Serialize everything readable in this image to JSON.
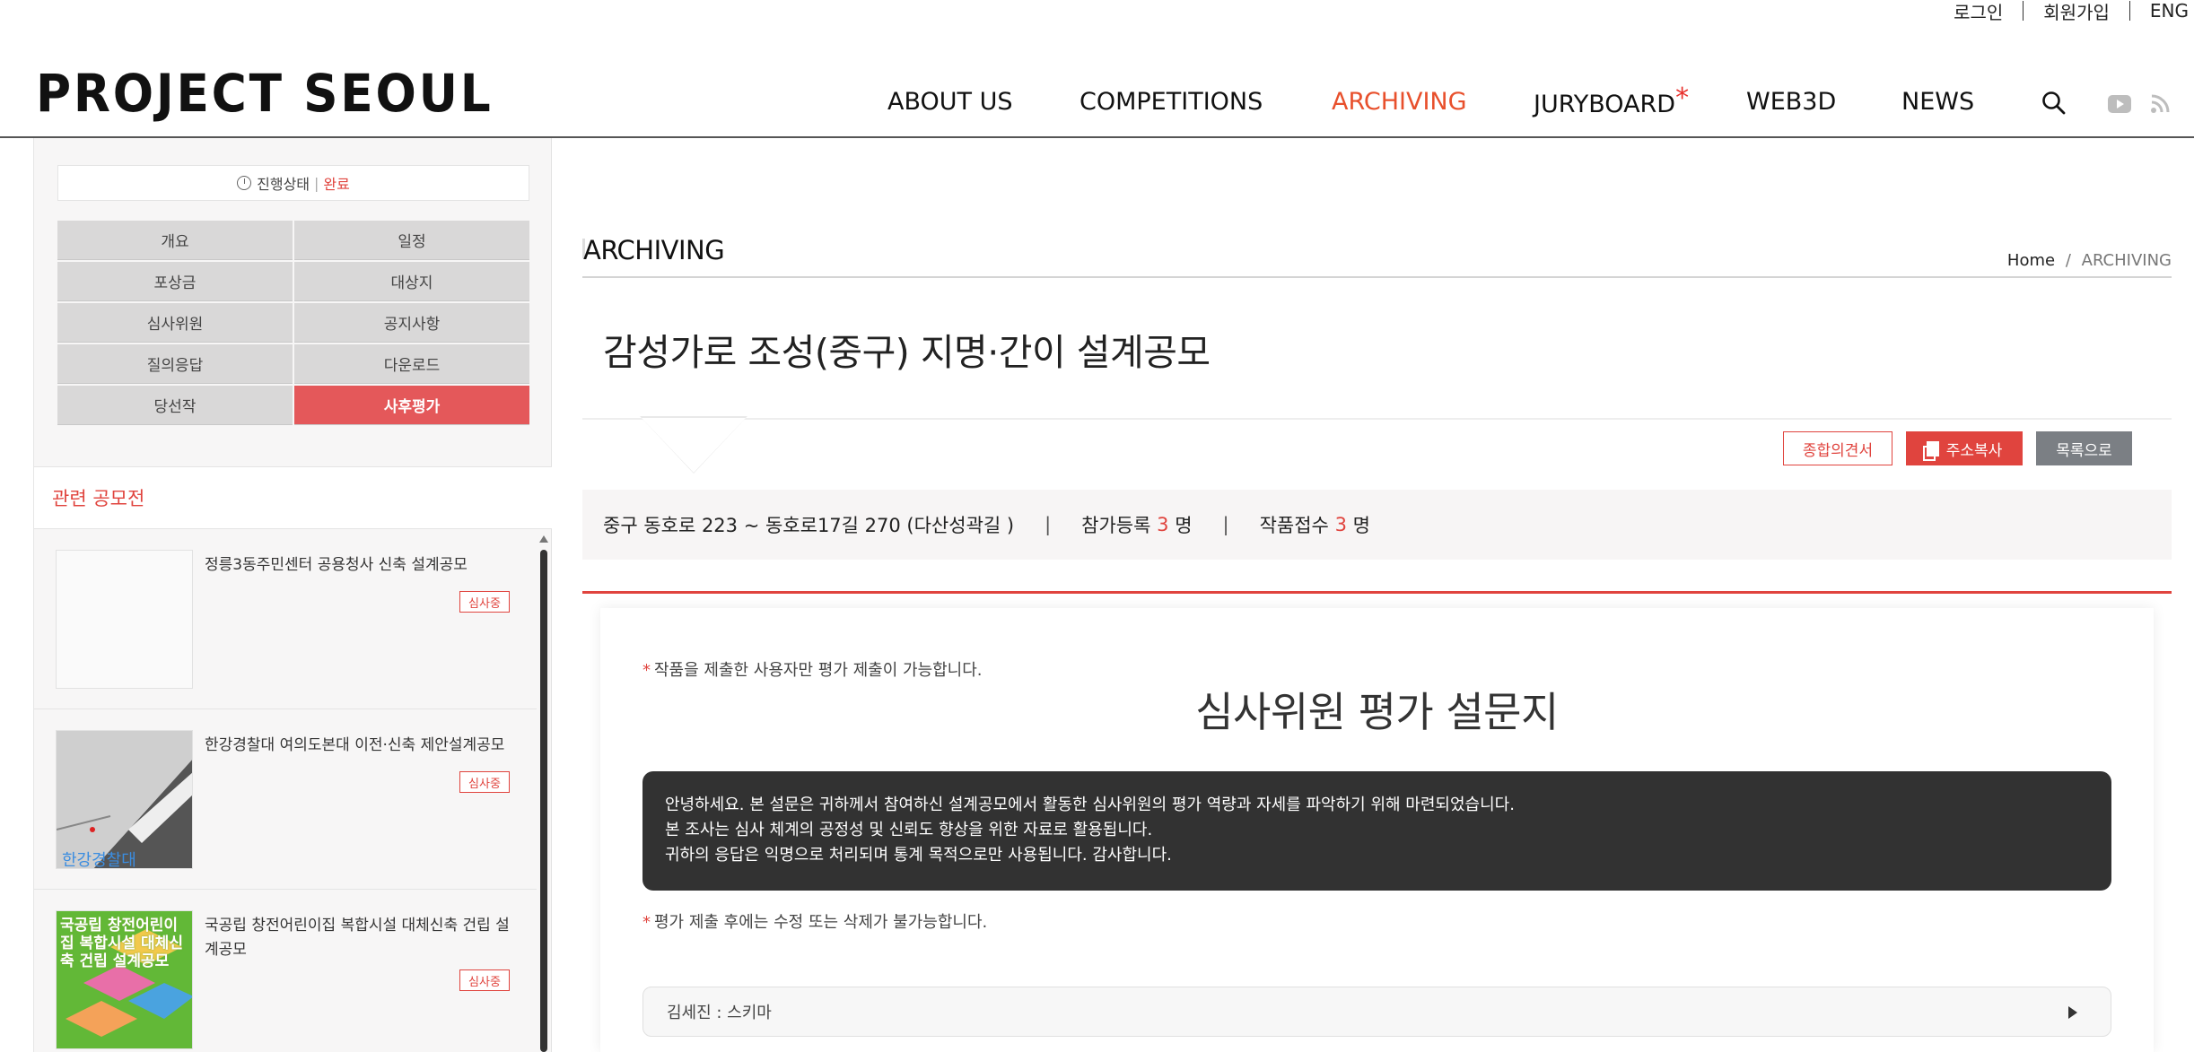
{
  "util_links": [
    "로그인",
    "회원가입",
    "ENG"
  ],
  "logo": "PROJECT SEOUL",
  "nav": [
    {
      "label": "ABOUT US"
    },
    {
      "label": "COMPETITIONS"
    },
    {
      "label": "ARCHIVING"
    },
    {
      "label": "JURYBOARD",
      "suffix": "*"
    },
    {
      "label": "WEB3D"
    },
    {
      "label": "NEWS"
    }
  ],
  "nav_icons": [
    "search-icon",
    "youtube-icon",
    "rss-icon"
  ],
  "sidebar": {
    "status_label": "진행상태",
    "status_value": "완료",
    "menu": [
      "개요",
      "일정",
      "포상금",
      "대상지",
      "심사위원",
      "공지사항",
      "질의응답",
      "다운로드",
      "당선작",
      "사후평가"
    ],
    "active_menu": "사후평가",
    "related_title": "관련 공모전",
    "related": [
      {
        "name": "정릉3동주민센터 공용청사 신축 설계공모",
        "badge": "심사중"
      },
      {
        "name": "한강경찰대 여의도본대 이전·신축 제안설계공모",
        "badge": "심사중",
        "thumb_text": "한강경찰대"
      },
      {
        "name": "국공립 창전어린이집 복합시설 대체신축 건립 설계공모",
        "badge": "심사중",
        "thumb_text": "국공립 창전어린이집 복합시설 대체신축 건립 설계공모"
      }
    ]
  },
  "main": {
    "section_title": "ARCHIVING",
    "breadcrumb_home": "Home",
    "breadcrumb_sep": "/",
    "breadcrumb_current": "ARCHIVING",
    "competition_title": "감성가로 조성(중구) 지명·간이 설계공모",
    "buttons": {
      "opinion": "종합의견서",
      "copy_address": "주소복사",
      "list": "목록으로"
    },
    "address": "중구 동호로 223 ~ 동호로17길 270 (다산성곽길 )",
    "registrations_label": "참가등록",
    "registrations": "3",
    "submissions_label": "작품접수",
    "submissions": "3",
    "unit": "명",
    "pipe": "|"
  },
  "survey": {
    "note_top": "작품을 제출한 사용자만 평가 제출이 가능합니다.",
    "title": "심사위원 평가 설문지",
    "intro_lines": [
      "안녕하세요. 본 설문은 귀하께서 참여하신 설계공모에서 활동한 심사위원의 평가 역량과 자세를 파악하기 위해 마련되었습니다.",
      "본 조사는 심사 체계의 공정성 및 신뢰도 향상을 위한 자료로 활용됩니다.",
      "귀하의 응답은 익명으로 처리되며 통계 목적으로만 사용됩니다. 감사합니다."
    ],
    "note_bottom": "평가 제출 후에는 수정 또는 삭제가 불가능합니다.",
    "accordion_label": "김세진 : 스키마",
    "asterisk": "*"
  },
  "colors": {
    "accent": "#e0443e",
    "nav_active": "#e8502c",
    "dark_box": "#323232"
  }
}
